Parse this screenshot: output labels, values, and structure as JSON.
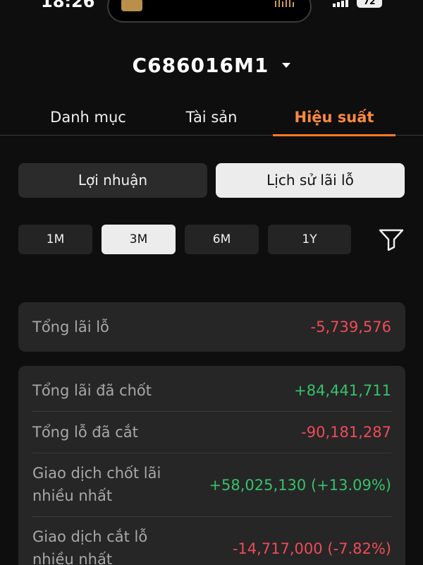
{
  "status_bar": {
    "time": "18:26",
    "battery": "72"
  },
  "account": {
    "name": "C686016M1"
  },
  "tabs": [
    {
      "label": "Danh mục"
    },
    {
      "label": "Tài sản"
    },
    {
      "label": "Hiệu suất",
      "active": true
    }
  ],
  "segments": [
    {
      "label": "Lợi nhuận"
    },
    {
      "label": "Lịch sử lãi lỗ",
      "active": true
    }
  ],
  "periods": [
    {
      "label": "1M"
    },
    {
      "label": "3M",
      "active": true
    },
    {
      "label": "6M"
    },
    {
      "label": "1Y"
    }
  ],
  "summary": {
    "label": "Tổng lãi lỗ",
    "value": "-5,739,576"
  },
  "details": [
    {
      "label": "Tổng lãi đã chốt",
      "value": "+84,441,711"
    },
    {
      "label": "Tổng lỗ đã cắt",
      "value": "-90,181,287"
    },
    {
      "label_line1": "Giao dịch chốt lãi",
      "label_line2": "nhiều nhất",
      "value": "+58,025,130 (+13.09%)"
    },
    {
      "label_line1": "Giao dịch cắt lỗ",
      "label_line2": "nhiều nhất",
      "value": "-14,717,000 (-7.82%)"
    }
  ],
  "colors": {
    "accent": "#ff7a29",
    "positive": "#36c26b",
    "negative": "#ef4b57",
    "background": "#0e0e0e",
    "card": "#262626"
  }
}
